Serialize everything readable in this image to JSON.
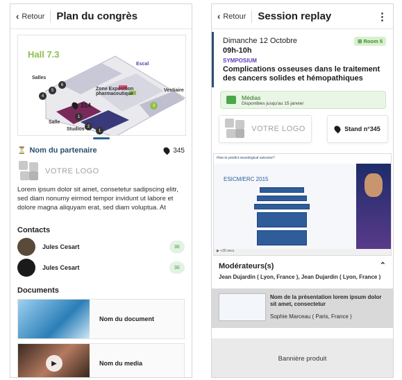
{
  "left": {
    "back_label": "Retour",
    "title": "Plan du congrès",
    "map": {
      "hall_title": "Hall 7.3",
      "labels": {
        "salles": "Salles",
        "zone": "Zone Exposition pharmaceutique",
        "salle": "Salle",
        "studios": "Studios",
        "vestiaire": "Vestiaire",
        "escal": "Escal",
        "stand": "314"
      },
      "numbers": [
        "4",
        "5",
        "6",
        "1",
        "2",
        "1",
        "3"
      ]
    },
    "partner": {
      "name": "Nom du partenaire",
      "booth": "345"
    },
    "logo_text": "VOTRE LOGO",
    "description": "Lorem ipsum dolor sit amet, consetetur sadipscing elitr, sed diam nonumy eirmod tempor invidunt ut labore et dolore magna aliquyam erat, sed diam voluptua. At",
    "contacts_heading": "Contacts",
    "contacts": [
      {
        "name": "Jules Cesart"
      },
      {
        "name": "Jules Cesart"
      }
    ],
    "documents_heading": "Documents",
    "documents": [
      {
        "label": "Nom du document"
      },
      {
        "label": "Nom du media"
      }
    ]
  },
  "right": {
    "back_label": "Retour",
    "title": "Session replay",
    "date": "Dimanche 12 Octobre",
    "time": "09h-10h",
    "session_type": "SYMPOSIUM",
    "room": "Room 5",
    "room_prefix": "⊞",
    "session_title": "Complications osseuses dans le traitement des cancers solides et hémopathiques",
    "media": {
      "title": "Médias",
      "subtitle": "Disponibles jusqu'au 15 janvier"
    },
    "logo_text": "VOTRE LOGO",
    "stand": "Stand n°345",
    "video": {
      "slide_title": "How to predict neurological outcome?",
      "slide_heading": "ESICM/ERC 2015",
      "controls": "+30 secs"
    },
    "moderators_heading": "Modérateurs(s)",
    "moderators": "Jean Dujardin ( Lyon, France ), Jean Dujardin ( Lyon, France )",
    "presentation": {
      "title": "Nom de la présentation lorem ipsum dolor sit amet, consectetur",
      "author": "Sophie Marceau ( Paris, France )"
    },
    "banner": "Bannière produit"
  },
  "colors": {
    "accent_blue": "#2c4f6f",
    "green": "#4aa84a",
    "purple": "#5a3db5"
  }
}
